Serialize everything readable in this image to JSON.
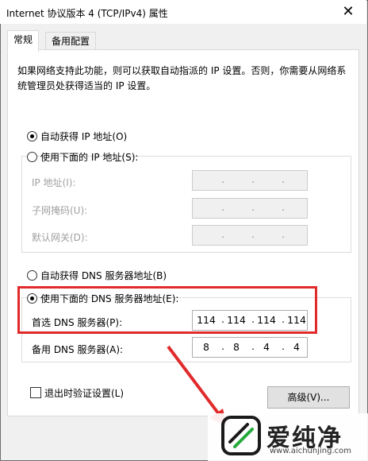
{
  "window": {
    "title": "Internet 协议版本 4 (TCP/IPv4) 属性",
    "close_glyph": "✕"
  },
  "tabs": [
    {
      "label": "常规"
    },
    {
      "label": "备用配置"
    }
  ],
  "description": "如果网络支持此功能，则可以获取自动指派的 IP 设置。否则，你需要从网络系统管理员处获得适当的 IP 设置。",
  "ip_section": {
    "auto_label": "自动获得 IP 地址(O)",
    "manual_label": "使用下面的 IP 地址(S):",
    "selected": "auto",
    "fields": [
      {
        "label": "IP 地址(I):",
        "value": [
          "",
          "",
          "",
          ""
        ]
      },
      {
        "label": "子网掩码(U):",
        "value": [
          "",
          "",
          "",
          ""
        ]
      },
      {
        "label": "默认网关(D):",
        "value": [
          "",
          "",
          "",
          ""
        ]
      }
    ]
  },
  "dns_section": {
    "auto_label": "自动获得 DNS 服务器地址(B)",
    "manual_label": "使用下面的 DNS 服务器地址(E):",
    "selected": "manual",
    "preferred": {
      "label": "首选 DNS 服务器(P):",
      "octets": [
        "114",
        "114",
        "114",
        "114"
      ]
    },
    "alternate": {
      "label": "备用 DNS 服务器(A):",
      "octets": [
        "8",
        "8",
        "4",
        "4"
      ]
    }
  },
  "validate_on_exit": {
    "label": "退出时验证设置(L)",
    "checked": false
  },
  "advanced_button": "高级(V)...",
  "annotation_color": "#e12b2b",
  "watermark": {
    "brand": "爱纯净",
    "url": "www.aichunjing.com"
  }
}
